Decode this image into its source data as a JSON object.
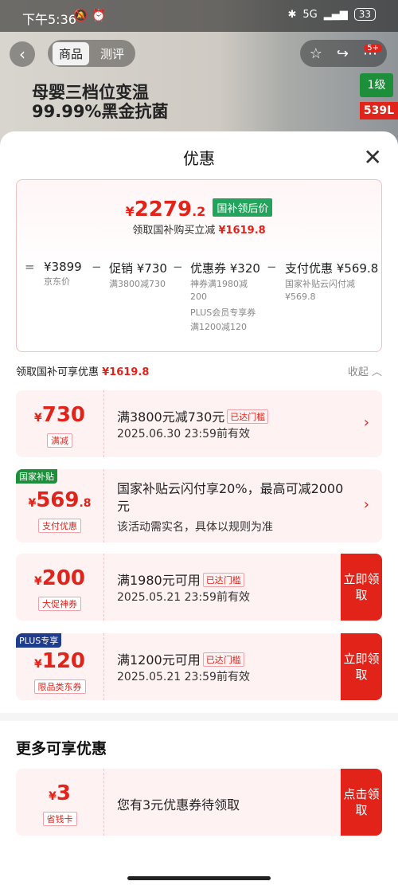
{
  "status_bar": {
    "time": "下午5:36",
    "network": "5G",
    "battery": "33"
  },
  "header": {
    "tabs": [
      "商品",
      "测评"
    ],
    "active_tab": "商品",
    "cart_badge": "5+"
  },
  "product_banner": {
    "promo_line1": "母婴三档位变温",
    "promo_line2": "99.99%黑金抗菌",
    "level_badge": "1级",
    "volume_badge": "539L"
  },
  "sheet": {
    "title": "优惠",
    "summary": {
      "currency": "¥",
      "final_price_int": "2279",
      "final_price_dec": ".2",
      "final_tag": "国补领后价",
      "subsidy_text": "领取国补购买立减",
      "subsidy_amount": "¥1619.8",
      "breakdown": [
        {
          "label": "¥3899",
          "sub": "京东价"
        },
        {
          "label": "促销 ¥730",
          "sub": "满3800减730"
        },
        {
          "label": "优惠券 ¥320",
          "sub": "神券满1980减200",
          "sub2": "PLUS会员专享券",
          "sub3": "满1200减120"
        },
        {
          "label": "支付优惠 ¥569.8",
          "sub": "国家补贴云闪付减¥569.8"
        }
      ],
      "ops": [
        "=",
        "−",
        "−",
        "−"
      ]
    },
    "available_label": "领取国补可享优惠",
    "available_amount": "¥1619.8",
    "collapse_label": "收起",
    "coupons": [
      {
        "currency": "¥",
        "amount": "730",
        "kind": "满减",
        "title": "满3800元减730元",
        "tag": "已达门槛",
        "sub": "2025.06.30 23:59前有效",
        "action": "chevron"
      },
      {
        "currency": "¥",
        "amount": "569",
        "amount_dec": ".8",
        "kind": "支付优惠",
        "corner": "国家补贴",
        "title": "国家补贴云闪付享20%，最高可减2000元",
        "sub": "该活动需实名，具体以规则为准",
        "action": "chevron"
      },
      {
        "currency": "¥",
        "amount": "200",
        "kind": "大促神券",
        "title": "满1980元可用",
        "tag": "已达门槛",
        "sub": "2025.05.21 23:59前有效",
        "action": "立即领取"
      },
      {
        "currency": "¥",
        "amount": "120",
        "kind": "限品类东券",
        "corner": "PLUS专享",
        "title": "满1200元可用",
        "tag": "已达门槛",
        "sub": "2025.05.21 23:59前有效",
        "action": "立即领取"
      }
    ],
    "more_title": "更多可享优惠",
    "more_coupons": [
      {
        "currency": "¥",
        "amount": "3",
        "kind": "省钱卡",
        "title": "您有3元优惠券待领取",
        "action": "点击领取"
      }
    ]
  },
  "colors": {
    "accent": "#e2231a",
    "green": "#23a45c",
    "plus": "#1f3d8f"
  }
}
